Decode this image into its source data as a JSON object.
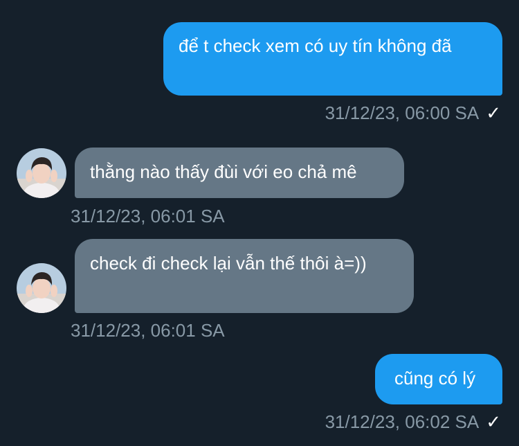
{
  "conversation": {
    "messages": [
      {
        "direction": "sent",
        "text": "để t check xem có uy tín không đã",
        "timestamp": "31/12/23, 06:00 SA",
        "status_icon": "check-icon"
      },
      {
        "direction": "received",
        "text": "thằng nào thấy đùi với eo chả mê",
        "timestamp": "31/12/23, 06:01 SA",
        "avatar_icon": "user-avatar"
      },
      {
        "direction": "received",
        "text": "check đi check lại vẫn thế thôi à=))",
        "timestamp": "31/12/23, 06:01 SA",
        "avatar_icon": "user-avatar"
      },
      {
        "direction": "sent",
        "text": "cũng có lý",
        "timestamp": "31/12/23, 06:02 SA",
        "status_icon": "check-icon"
      }
    ],
    "check_glyph": "✓"
  },
  "colors": {
    "background": "#15202b",
    "sent_bubble": "#1d9bf0",
    "received_bubble": "#657786",
    "timestamp": "#8899a6"
  }
}
